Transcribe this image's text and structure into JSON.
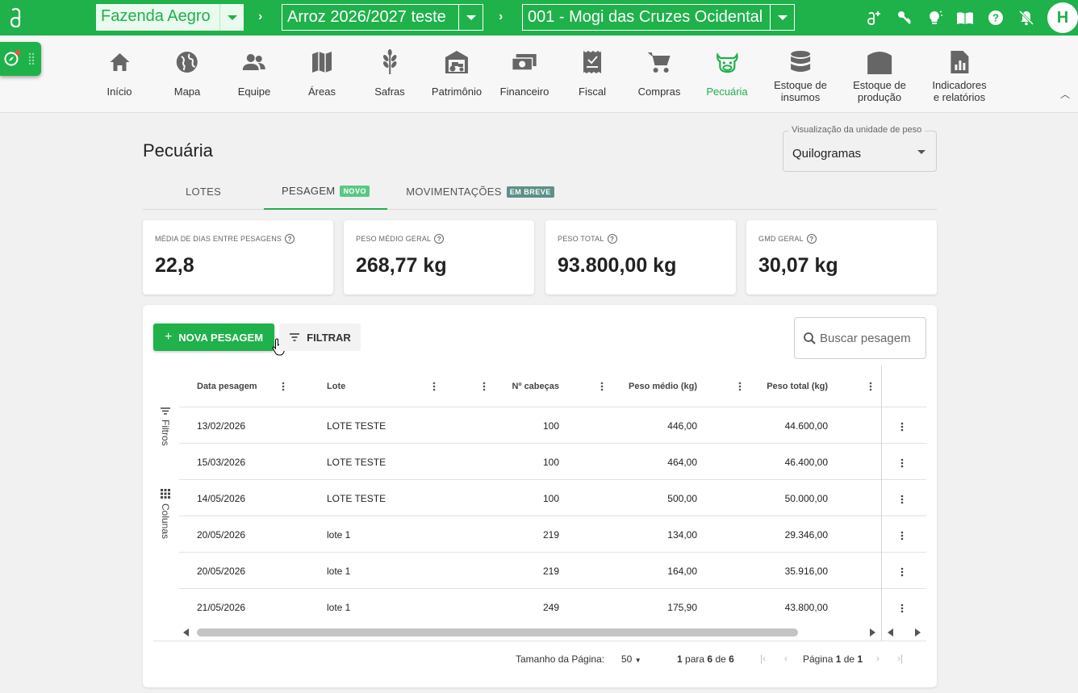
{
  "topbar": {
    "farm": "Fazenda Aegro",
    "season": "Arroz 2026/2027 teste",
    "area": "001 - Mogi das Cruzes Ocidental",
    "avatar_initial": "H",
    "accent": "#1fb14a"
  },
  "modules": [
    {
      "label": "Início",
      "icon": "home-icon"
    },
    {
      "label": "Mapa",
      "icon": "globe-icon"
    },
    {
      "label": "Equipe",
      "icon": "team-icon"
    },
    {
      "label": "Áreas",
      "icon": "map-icon"
    },
    {
      "label": "Safras",
      "icon": "wheat-icon"
    },
    {
      "label": "Patrimônio",
      "icon": "tractor-barn-icon"
    },
    {
      "label": "Financeiro",
      "icon": "money-icon"
    },
    {
      "label": "Fiscal",
      "icon": "receipt-icon"
    },
    {
      "label": "Compras",
      "icon": "cart-icon"
    },
    {
      "label": "Pecuária",
      "icon": "cow-icon"
    },
    {
      "label1": "Estoque de",
      "label2": "insumos",
      "icon": "database-icon"
    },
    {
      "label1": "Estoque de",
      "label2": "produção",
      "icon": "silo-icon"
    },
    {
      "label1": "Indicadores",
      "label2": "e relatórios",
      "icon": "report-icon"
    }
  ],
  "page": {
    "title": "Pecuária",
    "unit_label": "Visualização da unidade de peso",
    "unit_value": "Quilogramas"
  },
  "tabs": [
    {
      "label": "LOTES"
    },
    {
      "label": "PESAGEM",
      "badge": "NOVO"
    },
    {
      "label": "MOVIMENTAÇÕES",
      "badge": "EM BREVE"
    }
  ],
  "stats": [
    {
      "label": "MÉDIA DE DIAS ENTRE PESAGENS",
      "value": "22,8"
    },
    {
      "label": "PESO MÉDIO GERAL",
      "value": "268,77 kg"
    },
    {
      "label": "PESO TOTAL",
      "value": "93.800,00 kg"
    },
    {
      "label": "GMD GERAL",
      "value": "30,07 kg"
    }
  ],
  "toolbar": {
    "new_label": "NOVA PESAGEM",
    "filter_label": "FILTRAR",
    "search_placeholder": "Buscar pesagem"
  },
  "sidebar": {
    "filters": "Filtros",
    "columns": "Colunas"
  },
  "table": {
    "headers": [
      "Data pesagem",
      "Lote",
      "Nº cabeças",
      "Peso médio (kg)",
      "Peso total (kg)"
    ],
    "rows": [
      [
        "13/02/2026",
        "LOTE TESTE",
        "100",
        "446,00",
        "44.600,00"
      ],
      [
        "15/03/2026",
        "LOTE TESTE",
        "100",
        "464,00",
        "46.400,00"
      ],
      [
        "14/05/2026",
        "LOTE TESTE",
        "100",
        "500,00",
        "50.000,00"
      ],
      [
        "20/05/2026",
        "lote 1",
        "219",
        "134,00",
        "29.346,00"
      ],
      [
        "20/05/2026",
        "lote 1",
        "219",
        "164,00",
        "35.916,00"
      ],
      [
        "21/05/2026",
        "lote 1",
        "249",
        "175,90",
        "43.800,00"
      ]
    ]
  },
  "pagination": {
    "page_size_label": "Tamanho da Página:",
    "page_size": "50",
    "range_from": "1",
    "range_word": "para",
    "range_to": "6",
    "of_word": "de",
    "total": "6",
    "page_word": "Página",
    "page": "1",
    "pages": "1"
  }
}
